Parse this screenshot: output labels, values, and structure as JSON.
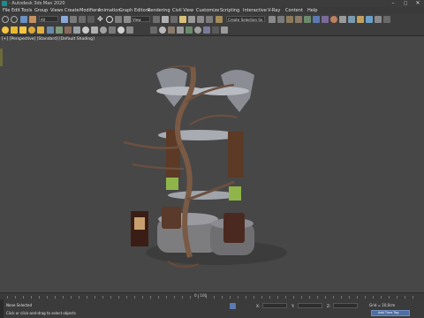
{
  "window": {
    "title": "- Autodesk 3ds Max 2020",
    "controls": {
      "minimize": "–",
      "maximize": "□",
      "close": "✕"
    }
  },
  "menu": [
    "File",
    "Edit",
    "Tools",
    "Group",
    "Views",
    "Create",
    "Modifiers",
    "Animation",
    "Graph Editors",
    "Rendering",
    "Civil View",
    "Customize",
    "Scripting",
    "Interactive",
    "V-Ray",
    "Content",
    "Help"
  ],
  "toolbar": {
    "undo_icon": "undo-icon",
    "selection_filter": "All",
    "reference_coord": "View",
    "named_selection": "Create Selection Se"
  },
  "viewport": {
    "label": "[+] [Perspective] [Standard] [Default Shading]",
    "scene": "bonsai tree holding two hourglass vessels on stone pedestals"
  },
  "timeslider": {
    "range": "0 / 100"
  },
  "status": {
    "selection": "None Selected",
    "prompt": "Click or click-and-drag to select objects",
    "x_label": "X:",
    "y_label": "Y:",
    "z_label": "Z:",
    "grid": "Grid = 10,0cm",
    "add_time_tag": "Add Time Tag"
  },
  "colors": {
    "accent": "#f4c542",
    "active_blue": "#4d6ea0",
    "viewport_bg": "#474747"
  }
}
